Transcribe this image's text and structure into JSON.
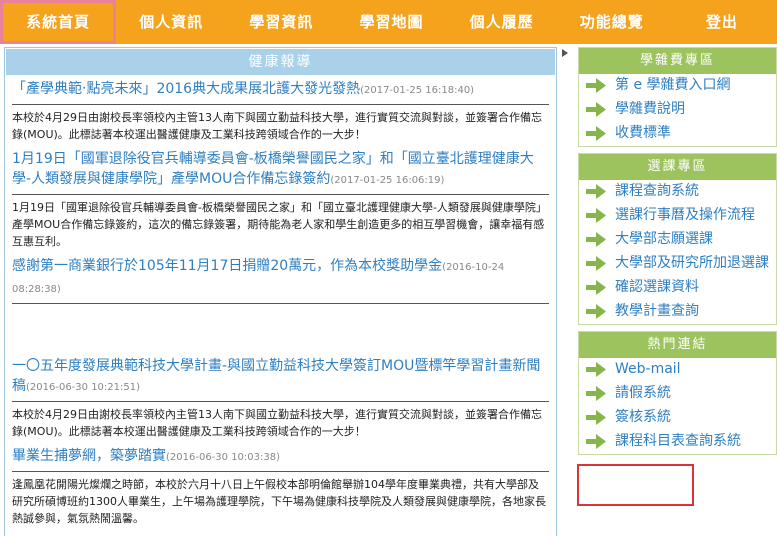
{
  "nav": {
    "items": [
      "系統首頁",
      "個人資訊",
      "學習資訊",
      "學習地圖",
      "個人履歷",
      "功能總覽",
      "登出"
    ],
    "active_index": 0
  },
  "news": {
    "header": "健康報導",
    "items": [
      {
        "title": "「產學典範‧點亮未來」2016典大成果展北護大發光發熱",
        "date": "(2017-01-25 16:18:40)",
        "body": "本校於4月29日由謝校長率領校內主管13人南下與國立勤益科技大學，進行實質交流與對談，並簽署合作備忘錄(MOU)。此標誌著本校運出醫護健康及工業科技跨領域合作的一大步！"
      },
      {
        "title": "1月19日「國軍退除役官兵輔導委員會-板橋榮譽國民之家」和「國立臺北護理健康大學-人類發展與健康學院」產學MOU合作備忘錄簽約",
        "date": "(2017-01-25 16:06:19)",
        "body": "1月19日「國軍退除役官兵輔導委員會-板橋榮譽國民之家」和「國立臺北護理健康大學-人類發展與健康學院」產學MOU合作備忘錄簽約，這次的備忘錄簽署，期待能為老人家和學生創造更多的相互學習機會，讓幸福有感互惠互利。"
      },
      {
        "title": "感謝第一商業銀行於105年11月17日捐贈20萬元，作為本校獎助學金",
        "date": "(2016-10-24 08:28:38)",
        "body": ""
      },
      {
        "title": "一〇五年度發展典範科技大學計畫-與國立勤益科技大學簽訂MOU暨標竿學習計畫新聞稿",
        "date": "(2016-06-30 10:21:51)",
        "body": "本校於4月29日由謝校長率領校內主管13人南下與國立勤益科技大學，進行實質交流與對談，並簽署合作備忘錄(MOU)。此標誌著本校運出醫護健康及工業科技跨領域合作的一大步！"
      },
      {
        "title": "畢業生捕夢網，築夢踏實",
        "date": "(2016-06-30 10:03:38)",
        "body": "逢鳳凰花開陽光燦爛之時節，本校於六月十八日上午假校本部明倫館舉辦104學年度畢業典禮，共有大學部及研究所碩博班約1300人畢業生，上午場為護理學院，下午場為健康科技學院及人類發展與健康學院，各地家長熱誠參與，氣氛熱鬧溫馨。"
      }
    ]
  },
  "sidebar": {
    "panels": [
      {
        "header": "學雜費專區",
        "items": [
          "第 e 學雜費入口網",
          "學雜費說明",
          "收費標準"
        ]
      },
      {
        "header": "選課專區",
        "items": [
          "課程查詢系統",
          "選課行事曆及操作流程",
          "大學部志願選課",
          "大學部及研究所加退選課",
          "確認選課資料",
          "教學計畫查詢"
        ]
      },
      {
        "header": "熱門連結",
        "items": [
          "Web-mail",
          "請假系統",
          "簽核系統",
          "課程科目表查詢系統"
        ]
      }
    ]
  },
  "colors": {
    "nav_bg": "#f5a21c",
    "active_outline": "#e8829a",
    "news_header": "#a9d2ea",
    "link_blue": "#2f7fc1",
    "sidebar_header": "#9dc35e",
    "arrow_green": "#86b64a",
    "highlight_red": "#d9343a"
  },
  "icons": {
    "sidebar_item": "green-arrow-right-icon",
    "panel_marker": "triangle-right-icon"
  }
}
